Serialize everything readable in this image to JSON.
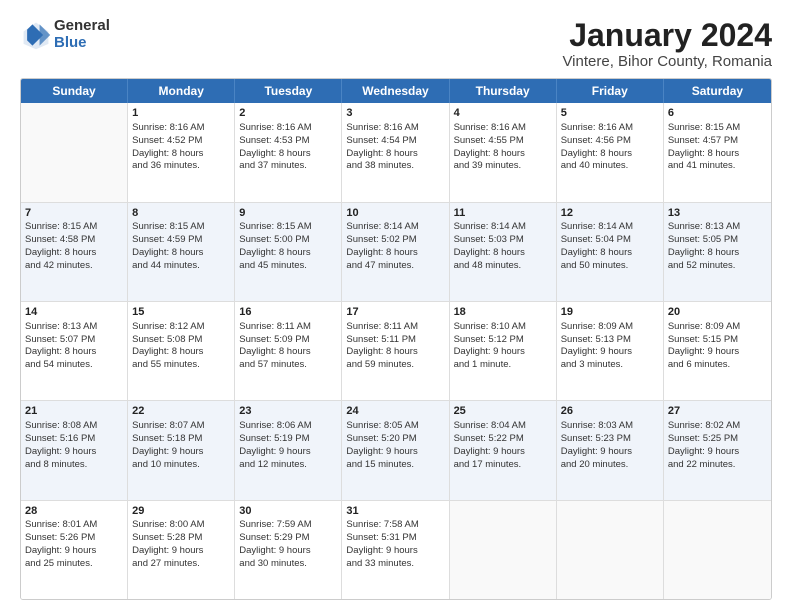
{
  "logo": {
    "general": "General",
    "blue": "Blue"
  },
  "title": "January 2024",
  "subtitle": "Vintere, Bihor County, Romania",
  "header_days": [
    "Sunday",
    "Monday",
    "Tuesday",
    "Wednesday",
    "Thursday",
    "Friday",
    "Saturday"
  ],
  "weeks": [
    [
      {
        "day": "",
        "lines": []
      },
      {
        "day": "1",
        "lines": [
          "Sunrise: 8:16 AM",
          "Sunset: 4:52 PM",
          "Daylight: 8 hours",
          "and 36 minutes."
        ]
      },
      {
        "day": "2",
        "lines": [
          "Sunrise: 8:16 AM",
          "Sunset: 4:53 PM",
          "Daylight: 8 hours",
          "and 37 minutes."
        ]
      },
      {
        "day": "3",
        "lines": [
          "Sunrise: 8:16 AM",
          "Sunset: 4:54 PM",
          "Daylight: 8 hours",
          "and 38 minutes."
        ]
      },
      {
        "day": "4",
        "lines": [
          "Sunrise: 8:16 AM",
          "Sunset: 4:55 PM",
          "Daylight: 8 hours",
          "and 39 minutes."
        ]
      },
      {
        "day": "5",
        "lines": [
          "Sunrise: 8:16 AM",
          "Sunset: 4:56 PM",
          "Daylight: 8 hours",
          "and 40 minutes."
        ]
      },
      {
        "day": "6",
        "lines": [
          "Sunrise: 8:15 AM",
          "Sunset: 4:57 PM",
          "Daylight: 8 hours",
          "and 41 minutes."
        ]
      }
    ],
    [
      {
        "day": "7",
        "lines": [
          "Sunrise: 8:15 AM",
          "Sunset: 4:58 PM",
          "Daylight: 8 hours",
          "and 42 minutes."
        ]
      },
      {
        "day": "8",
        "lines": [
          "Sunrise: 8:15 AM",
          "Sunset: 4:59 PM",
          "Daylight: 8 hours",
          "and 44 minutes."
        ]
      },
      {
        "day": "9",
        "lines": [
          "Sunrise: 8:15 AM",
          "Sunset: 5:00 PM",
          "Daylight: 8 hours",
          "and 45 minutes."
        ]
      },
      {
        "day": "10",
        "lines": [
          "Sunrise: 8:14 AM",
          "Sunset: 5:02 PM",
          "Daylight: 8 hours",
          "and 47 minutes."
        ]
      },
      {
        "day": "11",
        "lines": [
          "Sunrise: 8:14 AM",
          "Sunset: 5:03 PM",
          "Daylight: 8 hours",
          "and 48 minutes."
        ]
      },
      {
        "day": "12",
        "lines": [
          "Sunrise: 8:14 AM",
          "Sunset: 5:04 PM",
          "Daylight: 8 hours",
          "and 50 minutes."
        ]
      },
      {
        "day": "13",
        "lines": [
          "Sunrise: 8:13 AM",
          "Sunset: 5:05 PM",
          "Daylight: 8 hours",
          "and 52 minutes."
        ]
      }
    ],
    [
      {
        "day": "14",
        "lines": [
          "Sunrise: 8:13 AM",
          "Sunset: 5:07 PM",
          "Daylight: 8 hours",
          "and 54 minutes."
        ]
      },
      {
        "day": "15",
        "lines": [
          "Sunrise: 8:12 AM",
          "Sunset: 5:08 PM",
          "Daylight: 8 hours",
          "and 55 minutes."
        ]
      },
      {
        "day": "16",
        "lines": [
          "Sunrise: 8:11 AM",
          "Sunset: 5:09 PM",
          "Daylight: 8 hours",
          "and 57 minutes."
        ]
      },
      {
        "day": "17",
        "lines": [
          "Sunrise: 8:11 AM",
          "Sunset: 5:11 PM",
          "Daylight: 8 hours",
          "and 59 minutes."
        ]
      },
      {
        "day": "18",
        "lines": [
          "Sunrise: 8:10 AM",
          "Sunset: 5:12 PM",
          "Daylight: 9 hours",
          "and 1 minute."
        ]
      },
      {
        "day": "19",
        "lines": [
          "Sunrise: 8:09 AM",
          "Sunset: 5:13 PM",
          "Daylight: 9 hours",
          "and 3 minutes."
        ]
      },
      {
        "day": "20",
        "lines": [
          "Sunrise: 8:09 AM",
          "Sunset: 5:15 PM",
          "Daylight: 9 hours",
          "and 6 minutes."
        ]
      }
    ],
    [
      {
        "day": "21",
        "lines": [
          "Sunrise: 8:08 AM",
          "Sunset: 5:16 PM",
          "Daylight: 9 hours",
          "and 8 minutes."
        ]
      },
      {
        "day": "22",
        "lines": [
          "Sunrise: 8:07 AM",
          "Sunset: 5:18 PM",
          "Daylight: 9 hours",
          "and 10 minutes."
        ]
      },
      {
        "day": "23",
        "lines": [
          "Sunrise: 8:06 AM",
          "Sunset: 5:19 PM",
          "Daylight: 9 hours",
          "and 12 minutes."
        ]
      },
      {
        "day": "24",
        "lines": [
          "Sunrise: 8:05 AM",
          "Sunset: 5:20 PM",
          "Daylight: 9 hours",
          "and 15 minutes."
        ]
      },
      {
        "day": "25",
        "lines": [
          "Sunrise: 8:04 AM",
          "Sunset: 5:22 PM",
          "Daylight: 9 hours",
          "and 17 minutes."
        ]
      },
      {
        "day": "26",
        "lines": [
          "Sunrise: 8:03 AM",
          "Sunset: 5:23 PM",
          "Daylight: 9 hours",
          "and 20 minutes."
        ]
      },
      {
        "day": "27",
        "lines": [
          "Sunrise: 8:02 AM",
          "Sunset: 5:25 PM",
          "Daylight: 9 hours",
          "and 22 minutes."
        ]
      }
    ],
    [
      {
        "day": "28",
        "lines": [
          "Sunrise: 8:01 AM",
          "Sunset: 5:26 PM",
          "Daylight: 9 hours",
          "and 25 minutes."
        ]
      },
      {
        "day": "29",
        "lines": [
          "Sunrise: 8:00 AM",
          "Sunset: 5:28 PM",
          "Daylight: 9 hours",
          "and 27 minutes."
        ]
      },
      {
        "day": "30",
        "lines": [
          "Sunrise: 7:59 AM",
          "Sunset: 5:29 PM",
          "Daylight: 9 hours",
          "and 30 minutes."
        ]
      },
      {
        "day": "31",
        "lines": [
          "Sunrise: 7:58 AM",
          "Sunset: 5:31 PM",
          "Daylight: 9 hours",
          "and 33 minutes."
        ]
      },
      {
        "day": "",
        "lines": []
      },
      {
        "day": "",
        "lines": []
      },
      {
        "day": "",
        "lines": []
      }
    ]
  ]
}
